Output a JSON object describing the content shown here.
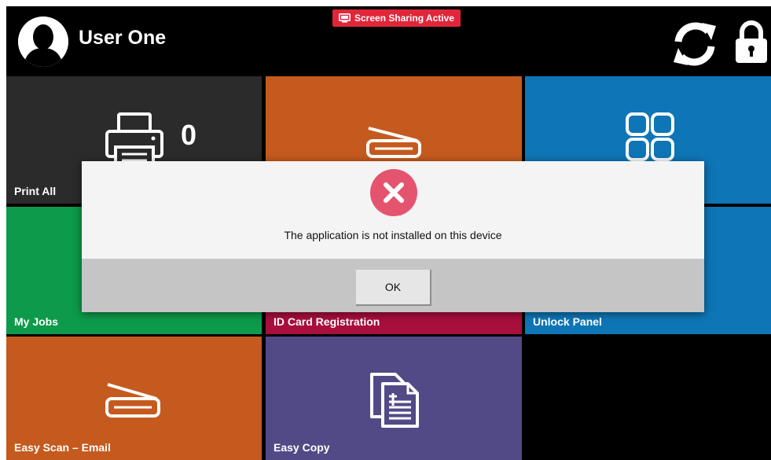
{
  "header": {
    "user_name": "User One",
    "share_badge": "Screen Sharing Active"
  },
  "tiles": {
    "print_all": {
      "label": "Print All",
      "count": "0"
    },
    "scan": {
      "label": ""
    },
    "apps": {
      "label": ""
    },
    "my_jobs": {
      "label": "My Jobs"
    },
    "id_card": {
      "label": "ID Card Registration"
    },
    "unlock_panel": {
      "label": "Unlock Panel"
    },
    "easy_scan": {
      "label": "Easy Scan – Email"
    },
    "easy_copy": {
      "label": "Easy Copy"
    }
  },
  "dialog": {
    "message": "The application is not installed on this device",
    "ok_label": "OK"
  },
  "icons": {
    "avatar": "user-avatar-icon",
    "share": "screen-share-icon",
    "refresh": "refresh-icon",
    "lock": "lock-icon",
    "print": "printer-icon",
    "scan": "scanner-icon",
    "apps": "apps-grid-icon",
    "copy": "copy-document-icon",
    "error": "error-x-icon"
  },
  "colors": {
    "print_tile": "#2b2b2b",
    "scan_tile": "#c55a1e",
    "apps_tile": "#0e76b6",
    "myjobs_tile": "#0d9a4a",
    "idcard_tile": "#a80f3d",
    "copy_tile": "#524a86",
    "share_badge": "#e2263a",
    "error_icon": "#e5546e"
  }
}
